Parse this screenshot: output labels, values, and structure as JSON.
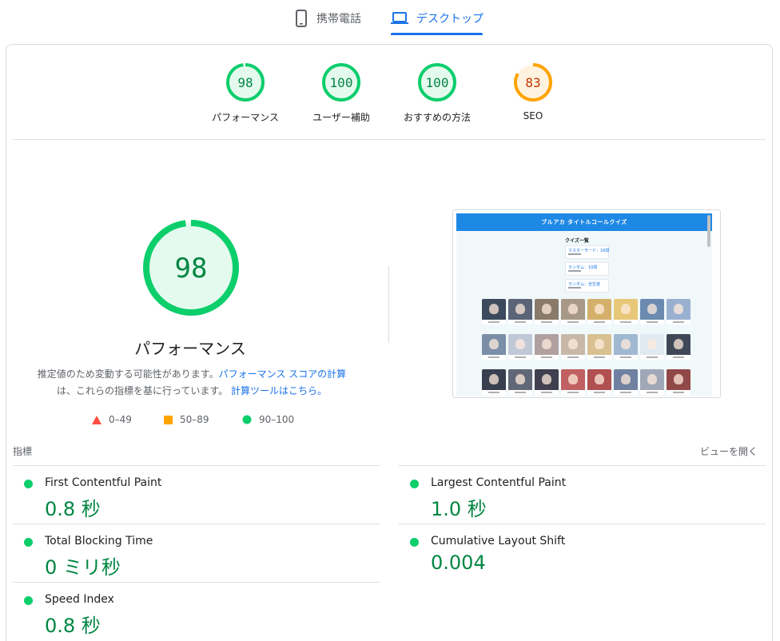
{
  "tabs": [
    {
      "label": "携帯電話",
      "icon": "smartphone-icon",
      "active": false
    },
    {
      "label": "デスクトップ",
      "icon": "laptop-icon",
      "active": true
    }
  ],
  "gauges": [
    {
      "score": "98",
      "label": "パフォーマンス",
      "status": "pass"
    },
    {
      "score": "100",
      "label": "ユーザー補助",
      "status": "pass"
    },
    {
      "score": "100",
      "label": "おすすめの方法",
      "status": "pass"
    },
    {
      "score": "83",
      "label": "SEO",
      "status": "average"
    }
  ],
  "performance": {
    "score": "98",
    "title": "パフォーマンス",
    "desc_part1": "推定値のため変動する可能性があります。",
    "desc_link1": "パフォーマンス スコアの計算",
    "desc_part2": "は、これらの指標を基に行っています。",
    "desc_link2": "計算ツールはこちら。"
  },
  "legend": [
    {
      "range": "0–49",
      "shape": "triangle",
      "color": "#ff4e42"
    },
    {
      "range": "50–89",
      "shape": "square",
      "color": "#ffa400"
    },
    {
      "range": "90–100",
      "shape": "circle",
      "color": "#0cce6b"
    }
  ],
  "screenshot": {
    "header": "ブルアカ タイトルコールクイズ",
    "list_title": "クイズ一覧",
    "items": [
      "マスターモード：16問",
      "ランダム：10問",
      "ランダム：全生徒"
    ]
  },
  "metrics": {
    "section_label": "指標",
    "expand_label": "ビューを開く",
    "fcp": {
      "label": "First Contentful Paint",
      "value": "0.8 秒"
    },
    "lcp": {
      "label": "Largest Contentful Paint",
      "value": "1.0 秒"
    },
    "tbt": {
      "label": "Total Blocking Time",
      "value": "0 ミリ秒"
    },
    "cls": {
      "label": "Cumulative Layout Shift",
      "value": "0.004"
    },
    "si": {
      "label": "Speed Index",
      "value": "0.8 秒"
    }
  },
  "colors": {
    "pass": "#0cce6b",
    "pass_text": "#018642",
    "pass_bg": "#e5faef",
    "average": "#ffa400",
    "average_text": "#c33300",
    "average_bg": "#fff3e0",
    "accent": "#1a73e8"
  }
}
